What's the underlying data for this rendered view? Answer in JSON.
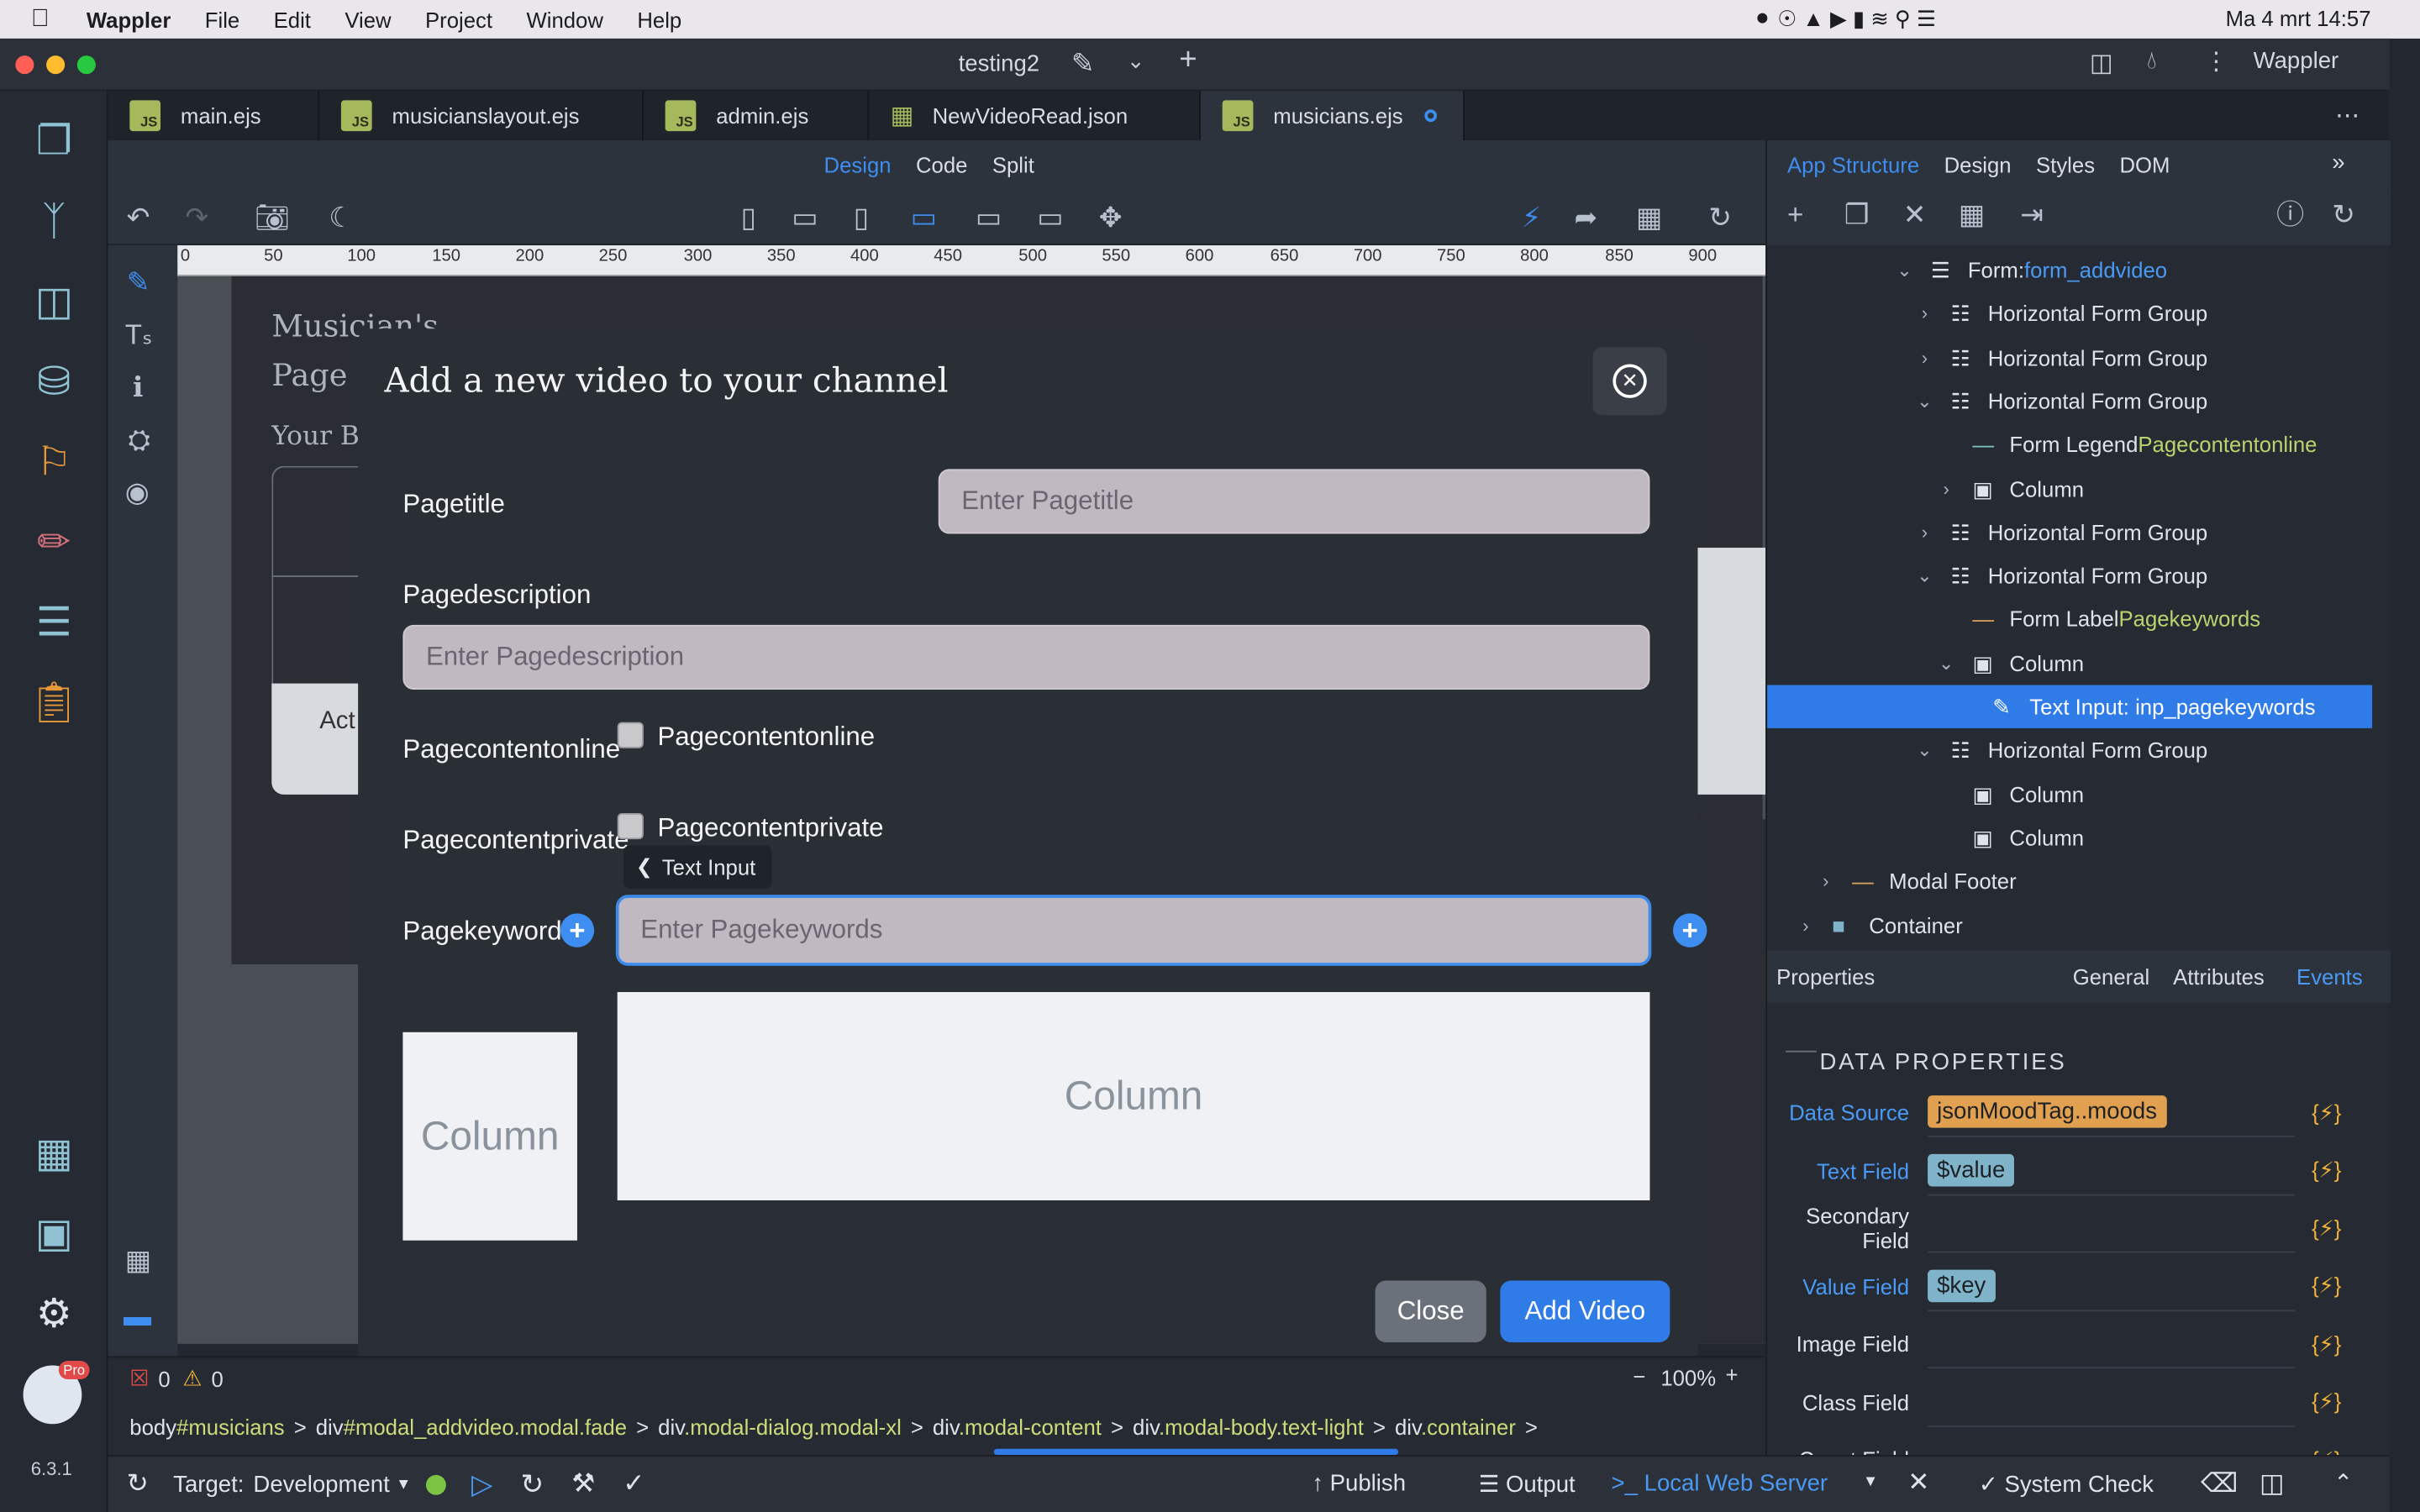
{
  "menubar": {
    "app": "Wappler",
    "items": [
      "File",
      "Edit",
      "View",
      "Project",
      "Window",
      "Help"
    ],
    "clock": "Ma 4 mrt  14:57"
  },
  "window": {
    "title": "testing2",
    "brand": "Wappler"
  },
  "tabs": [
    {
      "label": "main.ejs",
      "icon": "js-file-icon"
    },
    {
      "label": "musicianslayout.ejs",
      "icon": "js-file-icon"
    },
    {
      "label": "admin.ejs",
      "icon": "js-file-icon"
    },
    {
      "label": "NewVideoRead.json",
      "icon": "api-file-icon"
    },
    {
      "label": "musicians.ejs",
      "icon": "js-file-icon",
      "active": true
    }
  ],
  "view_modes": [
    "Design",
    "Code",
    "Split"
  ],
  "ruler": [
    "0",
    "50",
    "100",
    "150",
    "200",
    "250",
    "300",
    "350",
    "400",
    "450",
    "500",
    "550",
    "600",
    "650",
    "700",
    "750",
    "800",
    "850",
    "900"
  ],
  "background_page": {
    "title_line1": "Musician's",
    "title_line2": "Page",
    "subtitle": "Your B",
    "act": "Act"
  },
  "modal": {
    "title": "Add a new video to your channel",
    "fields": {
      "pagetitle_label": "Pagetitle",
      "pagetitle_placeholder": "Enter Pagetitle",
      "pagedescription_label": "Pagedescription",
      "pagedescription_placeholder": "Enter Pagedescription",
      "online_label": "Pagecontentonline",
      "online_check": "Pagecontentonline",
      "private_label": "Pagecontentprivate",
      "private_check": "Pagecontentprivate",
      "keywords_label": "Pagekeywords",
      "keywords_placeholder": "Enter Pagekeywords"
    },
    "tooltip": "Text Input",
    "column_small": "Column",
    "column_large": "Column",
    "close_button": "Close",
    "add_button": "Add Video"
  },
  "right_panel": {
    "tabs": [
      "App Structure",
      "Design",
      "Styles",
      "DOM"
    ],
    "tree": [
      {
        "text": "Form: ",
        "green": "form_addvideo",
        "indent": 1,
        "caret": "down"
      },
      {
        "text": "Horizontal Form Group",
        "indent": 2,
        "caret": "right"
      },
      {
        "text": "Horizontal Form Group",
        "indent": 2,
        "caret": "right"
      },
      {
        "text": "Horizontal Form Group",
        "indent": 2,
        "caret": "down"
      },
      {
        "text": "Form Legend ",
        "green": "Pagecontentonline",
        "indent": 3,
        "caret": ""
      },
      {
        "text": "Column",
        "indent": 3,
        "caret": "right"
      },
      {
        "text": "Horizontal Form Group",
        "indent": 2,
        "caret": "right"
      },
      {
        "text": "Horizontal Form Group",
        "indent": 2,
        "caret": "down"
      },
      {
        "text": "Form Label ",
        "green": "Pagekeywords",
        "indent": 3,
        "caret": ""
      },
      {
        "text": "Column",
        "indent": 3,
        "caret": "down"
      },
      {
        "text": "Text Input: inp_pagekeywords",
        "indent": 4,
        "caret": "",
        "selected": true
      },
      {
        "text": "Horizontal Form Group",
        "indent": 2,
        "caret": "down"
      },
      {
        "text": "Column",
        "indent": 3,
        "caret": ""
      },
      {
        "text": "Column",
        "indent": 3,
        "caret": ""
      },
      {
        "text": "Modal Footer",
        "indent": 0,
        "caret": "right"
      },
      {
        "text": "Container",
        "indent": -1,
        "caret": "right"
      }
    ],
    "properties": {
      "title": "Properties",
      "tabs": [
        "General",
        "Attributes",
        "Events"
      ],
      "section": "DATA PROPERTIES",
      "rows": [
        {
          "label": "Data Source",
          "value": "jsonMoodTag..moods",
          "chip": "#e0a04f"
        },
        {
          "label": "Text Field",
          "value": "$value",
          "chip": "#7fb3c9"
        },
        {
          "label": "Secondary Field",
          "value": ""
        },
        {
          "label": "Value Field",
          "value": "$key",
          "chip": "#7fb3c9"
        },
        {
          "label": "Image Field",
          "value": ""
        },
        {
          "label": "Class Field",
          "value": ""
        },
        {
          "label": "Count Field",
          "value": ""
        }
      ]
    }
  },
  "status": {
    "errors": "0",
    "warnings": "0",
    "zoom": "100%"
  },
  "breadcrumb": [
    {
      "tag": "body",
      "rest": "#musicians"
    },
    {
      "tag": "div",
      "rest": "#modal_addvideo.modal.fade"
    },
    {
      "tag": "div",
      "rest": ".modal-dialog.modal-xl"
    },
    {
      "tag": "div",
      "rest": ".modal-content"
    },
    {
      "tag": "div",
      "rest": ".modal-body.text-light"
    },
    {
      "tag": "div",
      "rest": ".container"
    }
  ],
  "bottom": {
    "target_label": "Target:",
    "target_value": "Development",
    "publish": "Publish",
    "output": "Output",
    "server": "Local Web Server",
    "system_check": "System Check",
    "version": "6.3.1"
  },
  "colors": {
    "accent": "#3d8ef0",
    "selected_row": "#2f7be8",
    "green_text": "#b9d36e"
  }
}
